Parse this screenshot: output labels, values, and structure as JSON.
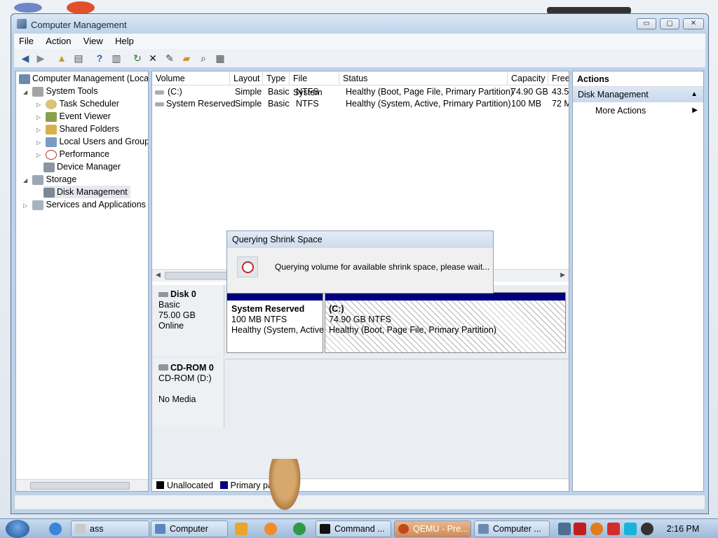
{
  "window": {
    "title": "Computer Management",
    "buttons": {
      "min": "▭",
      "max": "▢",
      "close": "✕"
    }
  },
  "menu": [
    "File",
    "Action",
    "View",
    "Help"
  ],
  "tree": {
    "items": [
      {
        "label": "Computer Management (Local",
        "level": 0,
        "twisty": ""
      },
      {
        "label": "System Tools",
        "level": 1,
        "twisty": "◢"
      },
      {
        "label": "Task Scheduler",
        "level": 2,
        "twisty": "▷"
      },
      {
        "label": "Event Viewer",
        "level": 2,
        "twisty": "▷"
      },
      {
        "label": "Shared Folders",
        "level": 2,
        "twisty": "▷"
      },
      {
        "label": "Local Users and Groups",
        "level": 2,
        "twisty": "▷"
      },
      {
        "label": "Performance",
        "level": 2,
        "twisty": "▷"
      },
      {
        "label": "Device Manager",
        "level": 2,
        "twisty": ""
      },
      {
        "label": "Storage",
        "level": 1,
        "twisty": "◢"
      },
      {
        "label": "Disk Management",
        "level": 2,
        "twisty": ""
      },
      {
        "label": "Services and Applications",
        "level": 1,
        "twisty": "▷"
      }
    ]
  },
  "volumes": {
    "columns": [
      "Volume",
      "Layout",
      "Type",
      "File System",
      "Status",
      "Capacity",
      "Free"
    ],
    "rows": [
      [
        "(C:)",
        "Simple",
        "Basic",
        "NTFS",
        "Healthy (Boot, Page File, Primary Partition)",
        "74.90 GB",
        "43.52"
      ],
      [
        "System Reserved",
        "Simple",
        "Basic",
        "NTFS",
        "Healthy (System, Active, Primary Partition)",
        "100 MB",
        "72 M"
      ]
    ]
  },
  "disks": {
    "disk0": {
      "name": "Disk 0",
      "type": "Basic",
      "size": "75.00 GB",
      "state": "Online"
    },
    "cdrom": {
      "name": "CD-ROM 0",
      "type": "CD-ROM (D:)",
      "media": "No Media"
    },
    "partitions": [
      {
        "name": "System Reserved",
        "size": "100 MB NTFS",
        "status": "Healthy (System, Active"
      },
      {
        "name": "(C:)",
        "size": "74.90 GB NTFS",
        "status": "Healthy (Boot, Page File, Primary Partition)"
      }
    ],
    "legend": {
      "unallocated": "Unallocated",
      "primary": "Primary part"
    }
  },
  "actions": {
    "header": "Actions",
    "section": "Disk Management",
    "more": "More Actions"
  },
  "dialog": {
    "title": "Querying Shrink Space",
    "message": "Querying volume for available shrink space, please wait..."
  },
  "taskbar": {
    "buttons": [
      "ass",
      "Computer",
      "Command ...",
      "QEMU - Pre...",
      "Computer ..."
    ],
    "clock": "2:16 PM"
  },
  "colors": {
    "primary_partition": "#00007f",
    "unallocated": "#000000"
  }
}
